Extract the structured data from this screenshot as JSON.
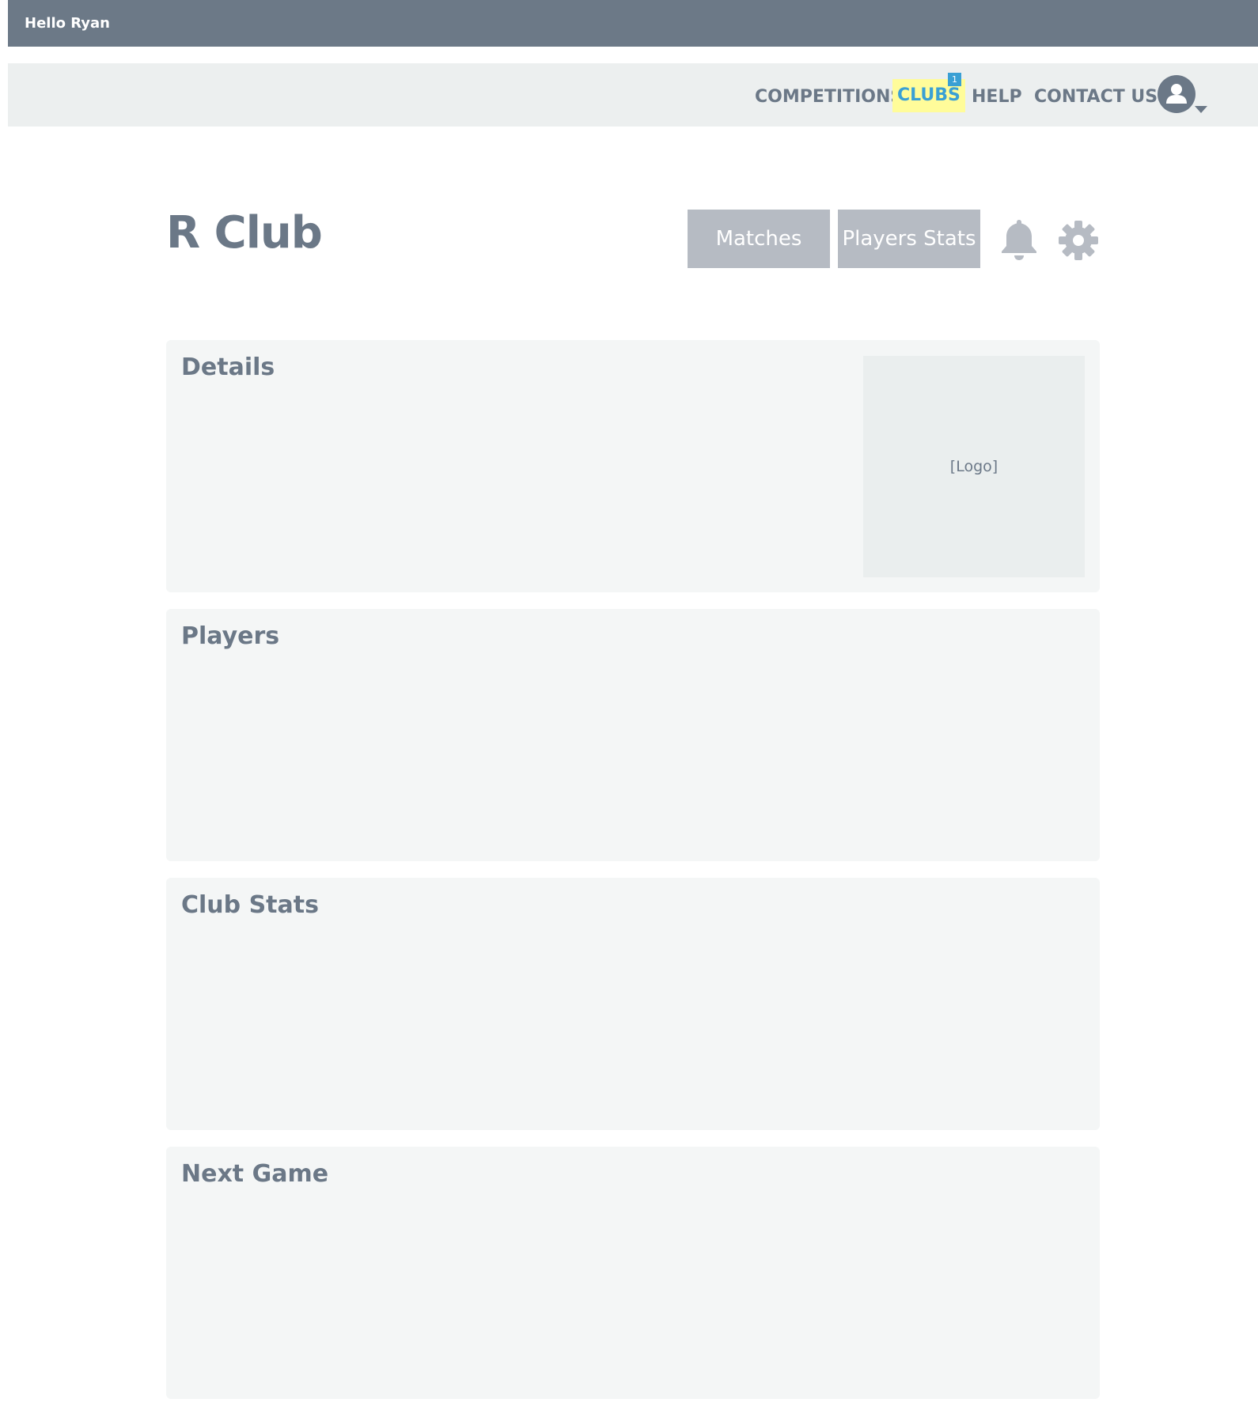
{
  "topbar": {
    "greeting": "Hello Ryan"
  },
  "nav": {
    "items": [
      {
        "label": "COMPETITIONS"
      },
      {
        "label": "CLUBS"
      },
      {
        "label": "HELP"
      },
      {
        "label": "CONTACT US"
      }
    ],
    "clubs_badge": "1",
    "active_item": "CLUBS",
    "active_highlight_color": "#fffc9a",
    "active_text_color": "#3aa0d4"
  },
  "header": {
    "title": "R Club",
    "buttons": [
      {
        "label": "Matches"
      },
      {
        "label": "Players Stats"
      }
    ],
    "icons": [
      "bell-icon",
      "gear-icon"
    ]
  },
  "panels": {
    "details": {
      "title": "Details",
      "logo_placeholder": "[Logo]"
    },
    "players": {
      "title": "Players"
    },
    "club_stats": {
      "title": "Club Stats"
    },
    "next_game": {
      "title": "Next Game"
    }
  },
  "colors": {
    "topbar": "#6c7987",
    "navbar": "#ecefef",
    "text": "#6b7887",
    "button": "#b6bbc3",
    "panel": "#f4f6f6",
    "badge": "#3aa0d4"
  }
}
